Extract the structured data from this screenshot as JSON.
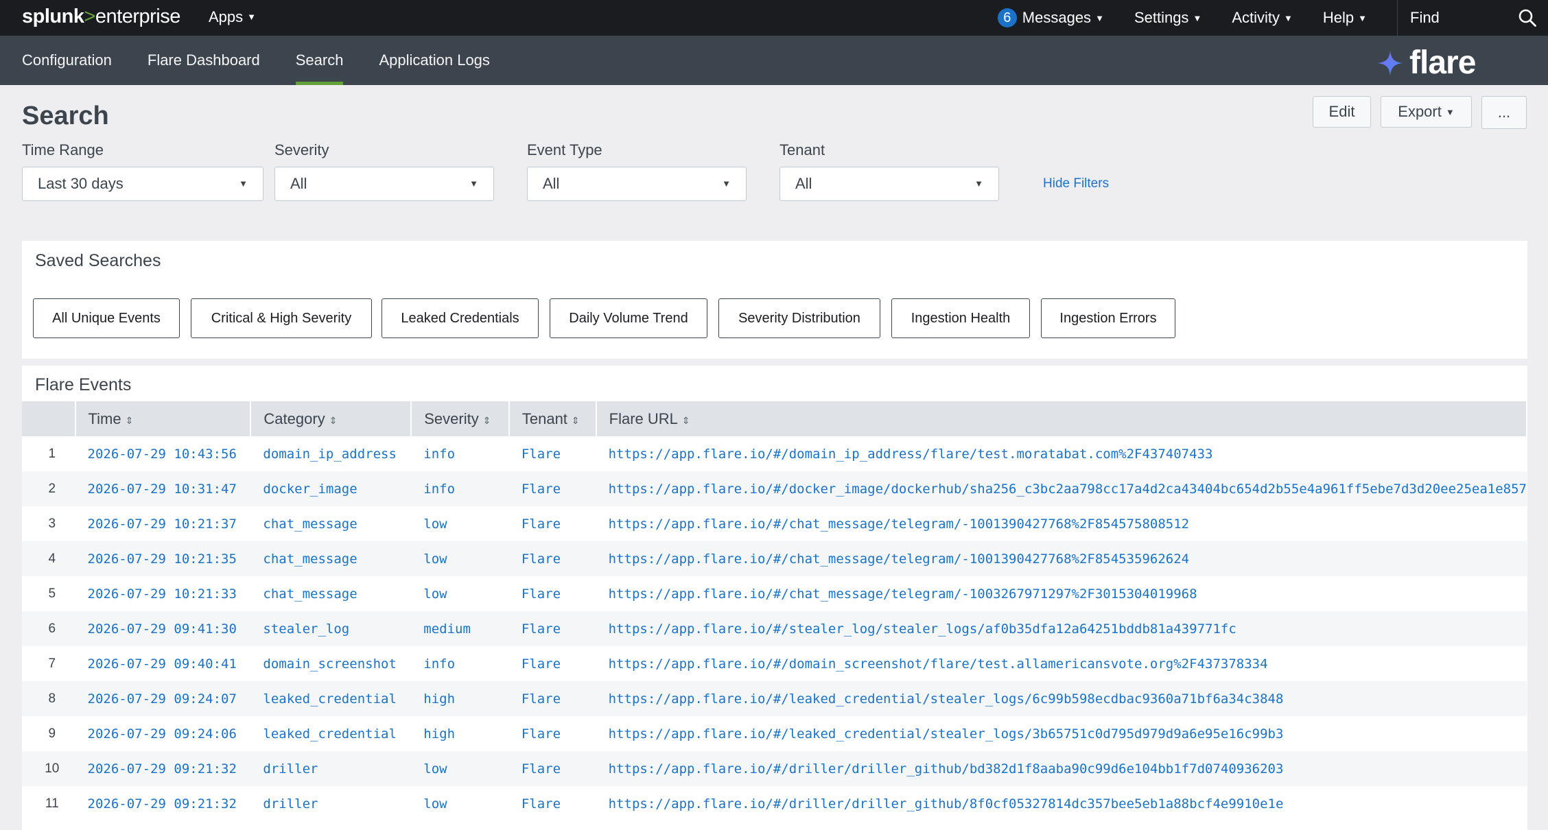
{
  "topbar": {
    "logo_part1": "splunk",
    "logo_part2": ">",
    "logo_part3": "enterprise",
    "apps": "Apps",
    "messages_count": "6",
    "messages": "Messages",
    "settings": "Settings",
    "activity": "Activity",
    "help": "Help",
    "find": "Find"
  },
  "appbar": {
    "nav": [
      "Configuration",
      "Flare Dashboard",
      "Search",
      "Application Logs"
    ],
    "active": "Search",
    "brand": "flare"
  },
  "header": {
    "title": "Search",
    "edit": "Edit",
    "export": "Export",
    "more": "..."
  },
  "filters": {
    "time_range": {
      "label": "Time Range",
      "value": "Last 30 days"
    },
    "severity": {
      "label": "Severity",
      "value": "All"
    },
    "event_type": {
      "label": "Event Type",
      "value": "All"
    },
    "tenant": {
      "label": "Tenant",
      "value": "All"
    },
    "hide": "Hide Filters"
  },
  "saved_searches": {
    "title": "Saved Searches",
    "buttons": [
      "All Unique Events",
      "Critical & High Severity",
      "Leaked Credentials",
      "Daily Volume Trend",
      "Severity Distribution",
      "Ingestion Health",
      "Ingestion Errors"
    ]
  },
  "events": {
    "title": "Flare Events",
    "columns": [
      "Time",
      "Category",
      "Severity",
      "Tenant",
      "Flare URL"
    ],
    "rows": [
      {
        "n": "1",
        "time": "2026-07-29 10:43:56",
        "category": "domain_ip_address",
        "severity": "info",
        "tenant": "Flare",
        "url": "https://app.flare.io/#/domain_ip_address/flare/test.moratabat.com%2F437407433"
      },
      {
        "n": "2",
        "time": "2026-07-29 10:31:47",
        "category": "docker_image",
        "severity": "info",
        "tenant": "Flare",
        "url": "https://app.flare.io/#/docker_image/dockerhub/sha256_c3bc2aa798cc17a4d2ca43404bc654d2b55e4a961ff5ebe7d3d20ee25ea1e857"
      },
      {
        "n": "3",
        "time": "2026-07-29 10:21:37",
        "category": "chat_message",
        "severity": "low",
        "tenant": "Flare",
        "url": "https://app.flare.io/#/chat_message/telegram/-1001390427768%2F854575808512"
      },
      {
        "n": "4",
        "time": "2026-07-29 10:21:35",
        "category": "chat_message",
        "severity": "low",
        "tenant": "Flare",
        "url": "https://app.flare.io/#/chat_message/telegram/-1001390427768%2F854535962624"
      },
      {
        "n": "5",
        "time": "2026-07-29 10:21:33",
        "category": "chat_message",
        "severity": "low",
        "tenant": "Flare",
        "url": "https://app.flare.io/#/chat_message/telegram/-1003267971297%2F3015304019968"
      },
      {
        "n": "6",
        "time": "2026-07-29 09:41:30",
        "category": "stealer_log",
        "severity": "medium",
        "tenant": "Flare",
        "url": "https://app.flare.io/#/stealer_log/stealer_logs/af0b35dfa12a64251bddb81a439771fc"
      },
      {
        "n": "7",
        "time": "2026-07-29 09:40:41",
        "category": "domain_screenshot",
        "severity": "info",
        "tenant": "Flare",
        "url": "https://app.flare.io/#/domain_screenshot/flare/test.allamericansvote.org%2F437378334"
      },
      {
        "n": "8",
        "time": "2026-07-29 09:24:07",
        "category": "leaked_credential",
        "severity": "high",
        "tenant": "Flare",
        "url": "https://app.flare.io/#/leaked_credential/stealer_logs/6c99b598ecdbac9360a71bf6a34c3848"
      },
      {
        "n": "9",
        "time": "2026-07-29 09:24:06",
        "category": "leaked_credential",
        "severity": "high",
        "tenant": "Flare",
        "url": "https://app.flare.io/#/leaked_credential/stealer_logs/3b65751c0d795d979d9a6e95e16c99b3"
      },
      {
        "n": "10",
        "time": "2026-07-29 09:21:32",
        "category": "driller",
        "severity": "low",
        "tenant": "Flare",
        "url": "https://app.flare.io/#/driller/driller_github/bd382d1f8aaba90c99d6e104bb1f7d0740936203"
      },
      {
        "n": "11",
        "time": "2026-07-29 09:21:32",
        "category": "driller",
        "severity": "low",
        "tenant": "Flare",
        "url": "https://app.flare.io/#/driller/driller_github/8f0cf05327814dc357bee5eb1a88bcf4e9910e1e"
      }
    ]
  }
}
